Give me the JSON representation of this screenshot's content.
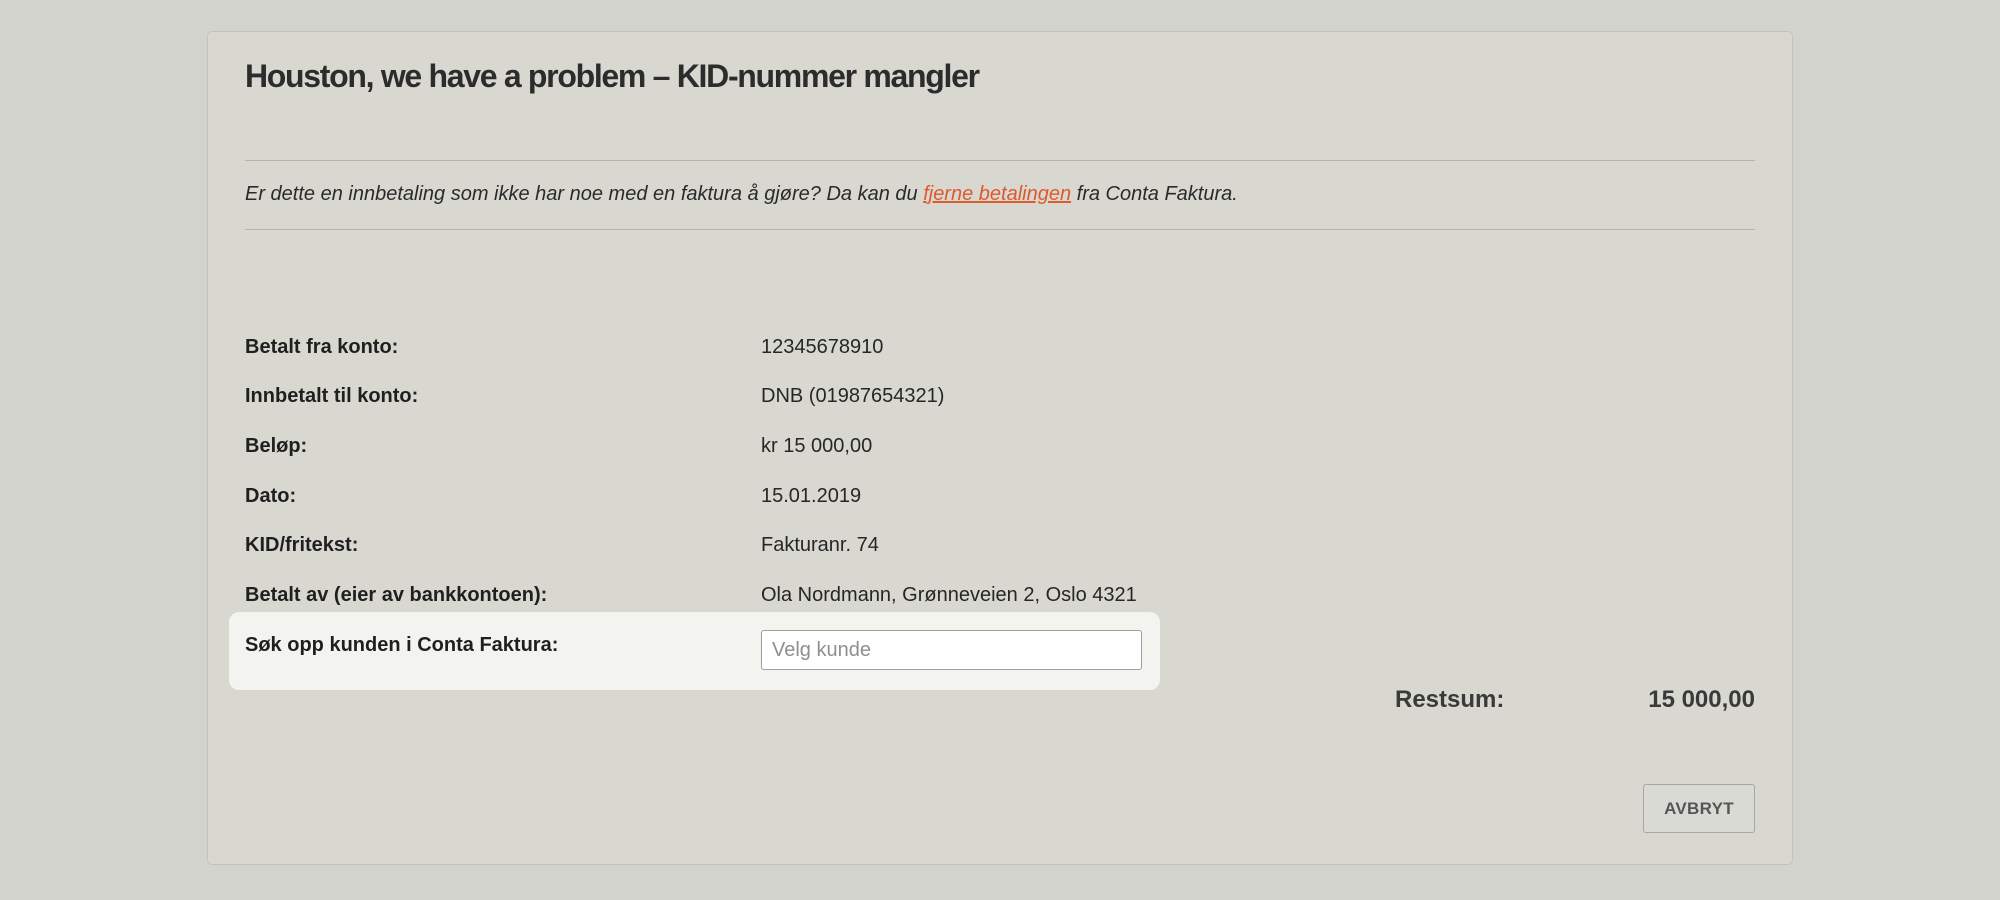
{
  "title": "Houston, we have a problem – KID-nummer mangler",
  "info": {
    "before": "Er dette en innbetaling som ikke har noe med en faktura å gjøre? Da kan du ",
    "link": "fjerne betalingen",
    "after": " fra Conta Faktura."
  },
  "rows": [
    {
      "label": "Betalt fra konto:",
      "value": "12345678910"
    },
    {
      "label": "Innbetalt til konto:",
      "value": "DNB (01987654321)"
    },
    {
      "label": "Beløp:",
      "value": "kr 15 000,00"
    },
    {
      "label": "Dato:",
      "value": "15.01.2019"
    },
    {
      "label": "KID/fritekst:",
      "value": "Fakturanr. 74"
    },
    {
      "label": "Betalt av (eier av bankkontoen):",
      "value": "Ola Nordmann, Grønneveien 2, Oslo 4321"
    }
  ],
  "customer_search": {
    "label": "Søk opp kunden i Conta Faktura:",
    "placeholder": "Velg kunde",
    "value": ""
  },
  "restsum": {
    "label": "Restsum:",
    "value": "15 000,00"
  },
  "cancel_label": "AVBRYT",
  "colors": {
    "link": "#de5a2c",
    "background": "#d3d3ce",
    "highlight": "#f3f3ef"
  }
}
